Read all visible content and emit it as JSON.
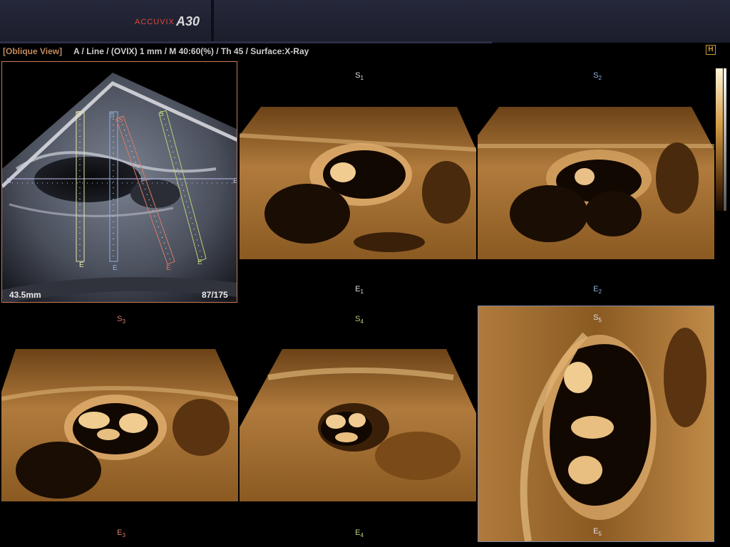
{
  "header": {
    "brand": "ACCUVIX",
    "model": "A30"
  },
  "infobar": {
    "view_tag": "[Oblique View]",
    "description": "A / Line / (OVIX) 1 mm / M 40:60(%) / Th 45 / Surface:X-Ray",
    "h_badge": "H"
  },
  "oblique_panel": {
    "depth": "43.5mm",
    "frame": "87/175",
    "lines": [
      {
        "start": "S1",
        "end": "E1",
        "color": "#e6e6a8"
      },
      {
        "start": "S2",
        "end": "E2",
        "color": "#8fb0e0"
      },
      {
        "start": "S3",
        "end": "E3",
        "color": "#d87a6a"
      },
      {
        "start": "S4",
        "end": "E4",
        "color": "#b8d07a"
      },
      {
        "start": "S5",
        "end": "E5",
        "color": "#c0c0e8"
      }
    ]
  },
  "panels": [
    {
      "name": "slice-1",
      "start_label": "S",
      "start_sub": "1",
      "end_label": "E",
      "end_sub": "1"
    },
    {
      "name": "slice-2",
      "start_label": "S",
      "start_sub": "2",
      "end_label": "E",
      "end_sub": "2"
    },
    {
      "name": "slice-3",
      "start_label": "S",
      "start_sub": "3",
      "end_label": "E",
      "end_sub": "3"
    },
    {
      "name": "slice-4",
      "start_label": "S",
      "start_sub": "4",
      "end_label": "E",
      "end_sub": "4"
    },
    {
      "name": "slice-5",
      "start_label": "S",
      "start_sub": "5",
      "end_label": "E",
      "end_sub": "5"
    }
  ],
  "colors": {
    "tag": "#c28a5a",
    "render_light": "#e8b978",
    "render_dark": "#1a0d04",
    "frame_oblique": "#c77a52"
  }
}
